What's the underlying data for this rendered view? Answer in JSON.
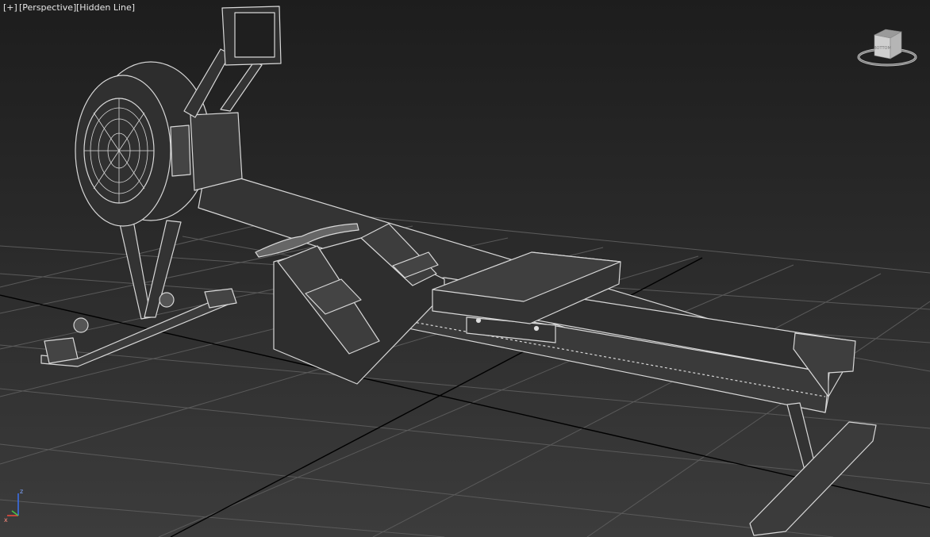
{
  "viewport": {
    "label_plus": "[+]",
    "label_view": "[Perspective]",
    "label_shading": "[Hidden Line]"
  },
  "viewcube": {
    "face_label": "BOTTOM",
    "icon": "viewcube-icon"
  },
  "axis_tripod": {
    "z_label": "z",
    "x_label": "x",
    "icon": "axis-tripod-icon"
  },
  "colors": {
    "background_top": "#1d1d1d",
    "background_bottom": "#3c3c3c",
    "grid_line": "#5a5a5a",
    "grid_axis": "#000000",
    "wire": "#d8d8d8",
    "surface": "#3a3a3a",
    "axis_z": "#3a6ee8",
    "axis_x": "#e84a3a",
    "axis_y": "#4ac04a"
  }
}
